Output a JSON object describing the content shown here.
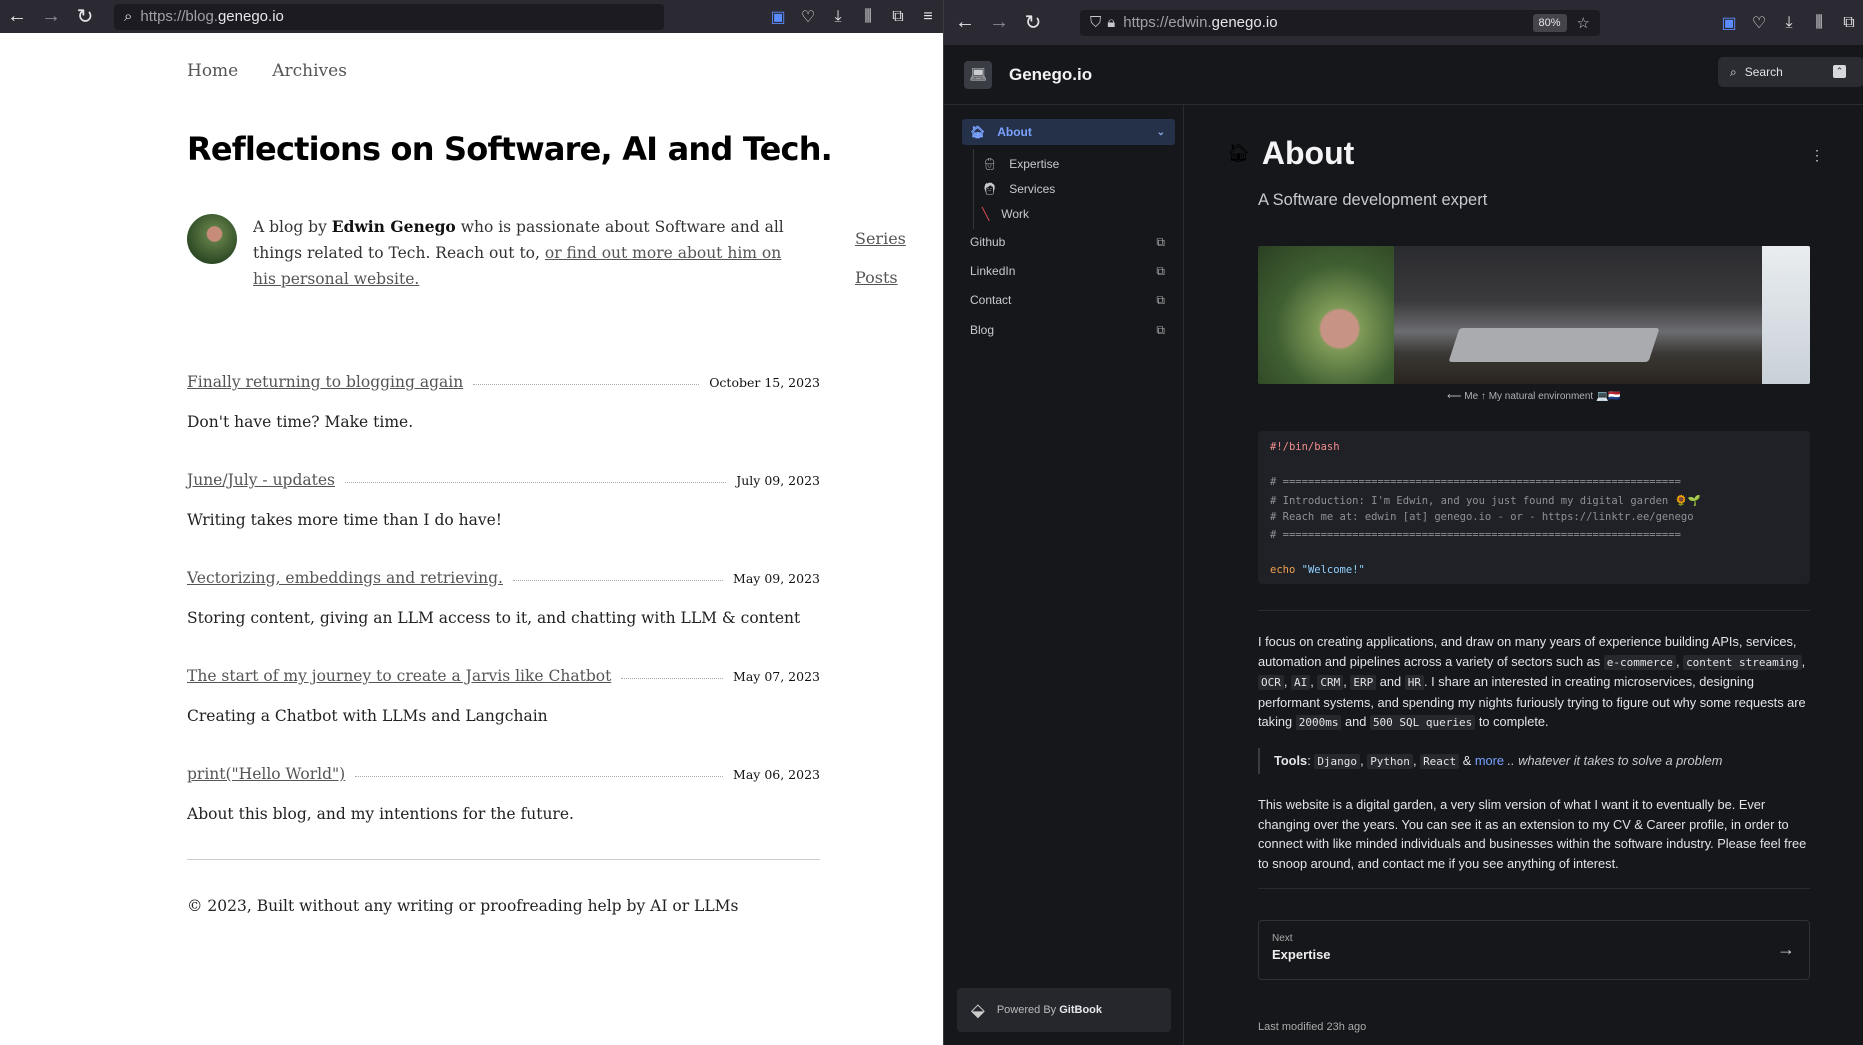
{
  "left": {
    "chrome": {
      "url_prefix": "https://blog.",
      "url_host": "genego.io"
    },
    "nav": [
      "Home",
      "Archives"
    ],
    "title": "Reflections on Software, AI and Tech.",
    "bio": {
      "part1": "A blog by ",
      "author": "Edwin Genego",
      "part2": " who is passionate about Software and all things related to Tech. Reach out to, ",
      "link": "or find out more about him on his personal website."
    },
    "side_links": [
      "Series",
      "Posts"
    ],
    "posts": [
      {
        "title": "Finally returning to blogging again",
        "date": "October 15, 2023",
        "summary": "Don't have time? Make time."
      },
      {
        "title": "June/July - updates",
        "date": "July 09, 2023",
        "summary": "Writing takes more time than I do have!"
      },
      {
        "title": "Vectorizing, embeddings and retrieving.",
        "date": "May 09, 2023",
        "summary": "Storing content, giving an LLM access to it, and chatting with LLM & content"
      },
      {
        "title": "The start of my journey to create a Jarvis like Chatbot",
        "date": "May 07, 2023",
        "summary": "Creating a Chatbot with LLMs and Langchain"
      },
      {
        "title": "print(\"Hello World\")",
        "date": "May 06, 2023",
        "summary": "About this blog, and my intentions for the future."
      }
    ],
    "footer": "© 2023, Built without any writing or proofreading help by AI or LLMs"
  },
  "right": {
    "chrome": {
      "url_prefix": "https://edwin.",
      "url_host": "genego.io",
      "zoom": "80%"
    },
    "site_title": "Genego.io",
    "search": "Search",
    "nav": {
      "active": "About",
      "sub": [
        "Expertise",
        "Services",
        "Work"
      ],
      "external": [
        "Github",
        "LinkedIn",
        "Contact",
        "Blog"
      ]
    },
    "powered_prefix": "Powered By ",
    "powered_brand": "GitBook",
    "page_title": "About",
    "subtitle": "A Software development expert",
    "caption": "⟵ Me ↑ My natural environment 💻🇳🇱",
    "code": {
      "shebang": "#!/bin/bash",
      "sep": "# ===============================================================",
      "intro": "# Introduction: I'm Edwin, and you just found my digital garden 🌻🌱",
      "reach": "# Reach me at: edwin [at] genego.io - or - https://linktr.ee/genego",
      "echo_kw": "echo",
      "echo_str": "\"Welcome!\""
    },
    "p1": {
      "t1": "I focus on creating applications, and draw on many years of experience building APIs, services, automation and pipelines across a variety of sectors such as ",
      "c1": "e-commerce",
      "t2": ", ",
      "c2": "content streaming",
      "t3": ", ",
      "c3": "OCR",
      "t4": ", ",
      "c4": "AI",
      "t5": ", ",
      "c5": "CRM",
      "t6": ", ",
      "c6": "ERP",
      "t7": " and ",
      "c7": "HR",
      "t8": ". I share an interested in creating microservices, designing performant systems, and spending my nights furiously trying to figure out why some requests are taking ",
      "c8": "2000ms",
      "t9": " and ",
      "c9": "500 SQL queries",
      "t10": " to complete."
    },
    "tools": {
      "label": "Tools",
      "colon": ": ",
      "items": [
        "Django",
        "Python",
        "React"
      ],
      "amp": " & ",
      "more": "more",
      "tail": " .. whatever it takes to solve a problem"
    },
    "p2": "This website is a digital garden, a very slim version of what I want it to eventually be. Ever changing over the years. You can see it as an extension to my CV & Career profile, in order to connect with like minded individuals and businesses within the software industry. Please feel free to snoop around, and contact me if you see anything of interest.",
    "next": {
      "label": "Next",
      "title": "Expertise"
    },
    "modified": "Last modified 23h ago"
  }
}
